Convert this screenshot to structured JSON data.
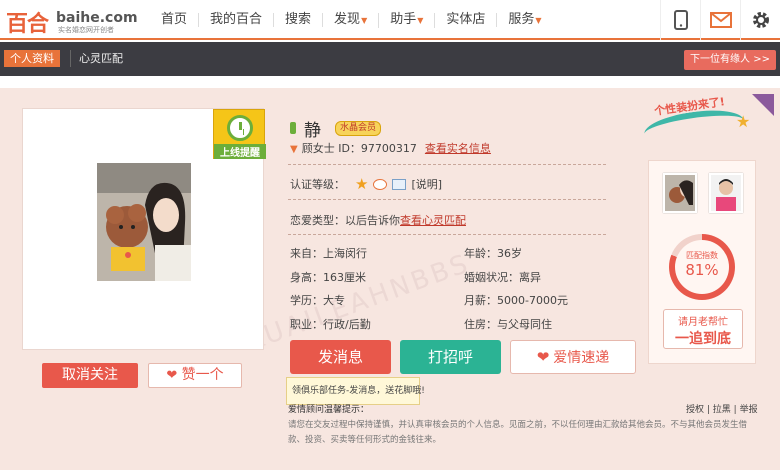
{
  "logo": {
    "text_cn": "百合",
    "text_en": "baihe.com",
    "tagline": "实名婚恋网开创者"
  },
  "nav": [
    {
      "label": "首页",
      "caret": false
    },
    {
      "label": "我的百合",
      "caret": false
    },
    {
      "label": "搜索",
      "caret": false
    },
    {
      "label": "发现",
      "caret": true
    },
    {
      "label": "助手",
      "caret": true
    },
    {
      "label": "实体店",
      "caret": false
    },
    {
      "label": "服务",
      "caret": true
    }
  ],
  "top_icons": [
    "mobile-icon",
    "mail-icon",
    "gear-icon"
  ],
  "subnav": {
    "active_tab": "个人资料",
    "tab2": "心灵匹配",
    "next_button": "下一位有缘人 >>"
  },
  "profile": {
    "online_badge": "上线提醒",
    "name": "静",
    "vip_label": "水晶会员",
    "id_text": "顾女士 ID：97700317",
    "id_link": "查看实名信息",
    "cert_label": "认证等级：",
    "cert_explain": "[说明]",
    "love_type_label": "恋爱类型：以后告诉你",
    "love_type_link": "查看心灵匹配",
    "details": [
      {
        "left": "来自：上海闵行",
        "right": "年龄：36岁"
      },
      {
        "left": "身高：163厘米",
        "right": "婚姻状况：离异"
      },
      {
        "left": "学历：大专",
        "right": "月薪：5000-7000元"
      },
      {
        "left": "职业：行政/后勤",
        "right": "住房：与父母同住"
      }
    ]
  },
  "actions": {
    "unfollow": "取消关注",
    "like": "赞一个",
    "send_message": "发消息",
    "say_hi": "打招呼",
    "love_express": "爱情速递",
    "tooltip": "领俱乐部任务-发消息，送花脚哦!"
  },
  "notice": {
    "title": "爱情顾问温馨提示：",
    "links": [
      "授权",
      "拉黑",
      "举报"
    ],
    "body": "请您在交友过程中保持谨慎，并认真审核会员的个人信息。见面之前，不以任何理由汇款给其他会员。不与其他会员发生借款、投资、买卖等任何形式的金钱往来。"
  },
  "right_panel": {
    "banner": "个性装扮来了!",
    "match_label": "匹配指数",
    "match_value": "81%",
    "match_fraction": 0.81,
    "matchmaker_line1": "请月老帮忙",
    "matchmaker_line2": "一追到底"
  },
  "watermark": "KUAILEAHNBBS",
  "colors": {
    "accent": "#e8733a",
    "red": "#e8584b",
    "teal": "#2bb394",
    "dark_bar": "#3c3c42"
  }
}
